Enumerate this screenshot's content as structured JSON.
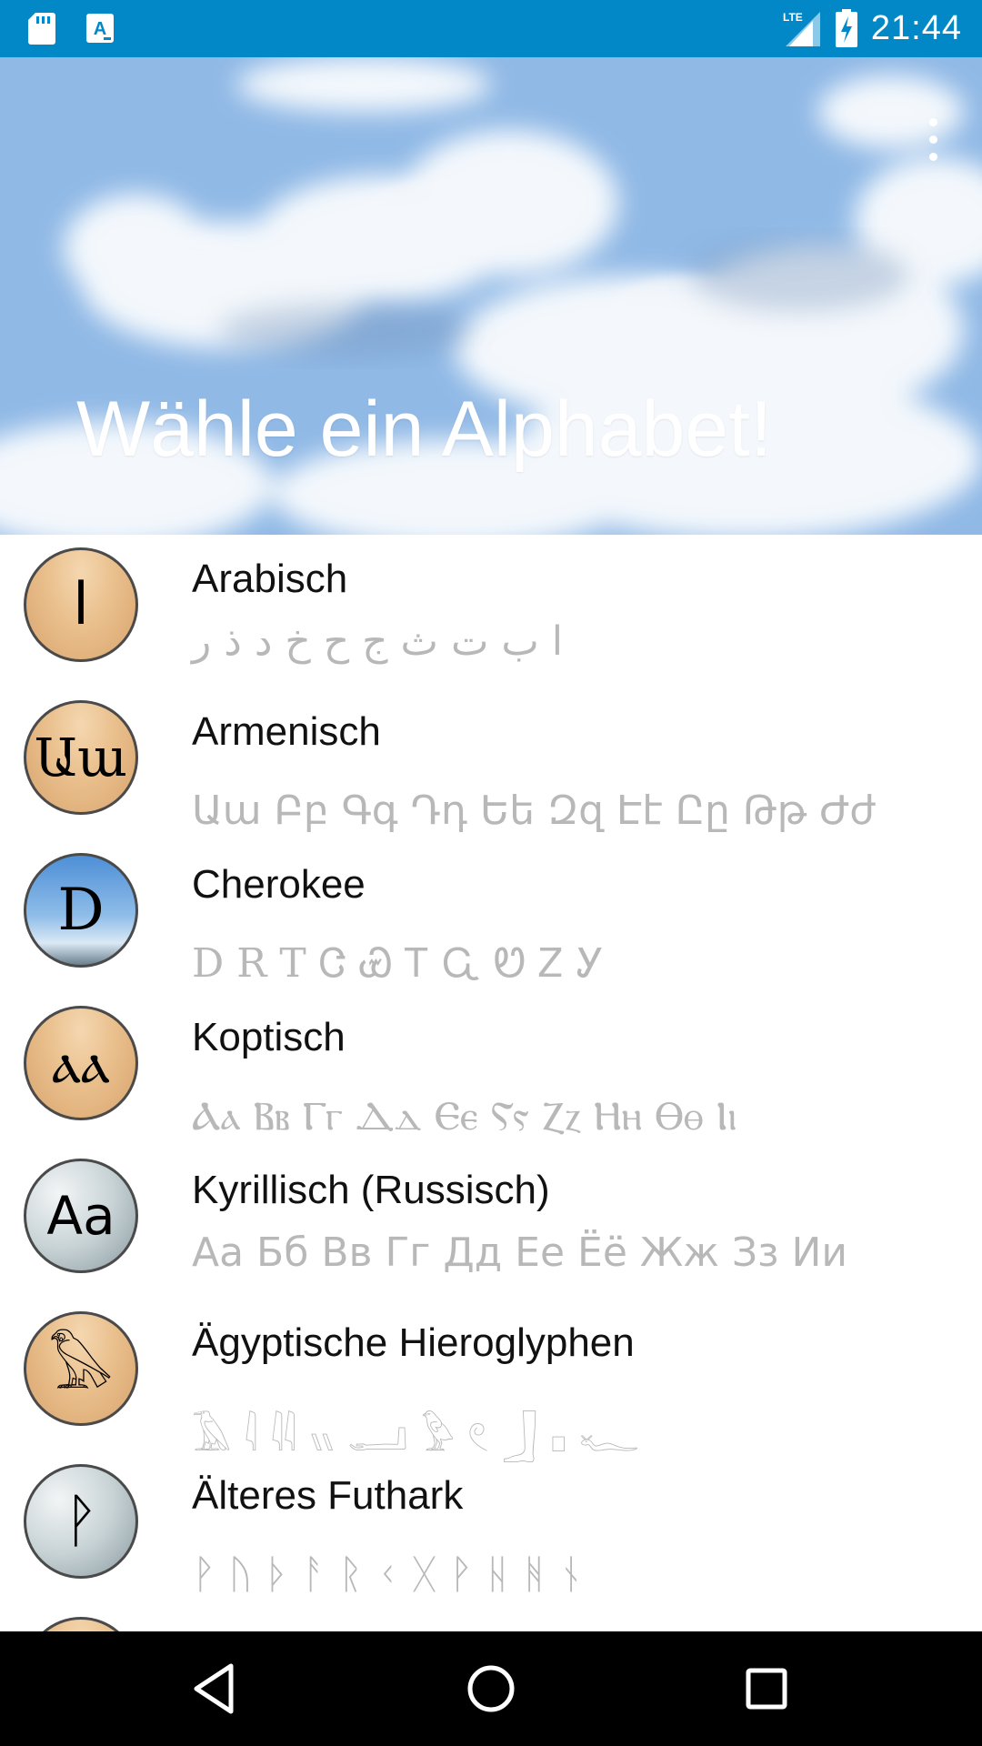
{
  "status_bar": {
    "time": "21:44",
    "network": "LTE",
    "icons": [
      "sd-card-icon",
      "app-notification-icon",
      "lte-signal-icon",
      "battery-charging-icon"
    ]
  },
  "header": {
    "title": "Wähle ein Alphabet!",
    "menu_icon": "overflow-menu-icon"
  },
  "alphabets": [
    {
      "name": "Arabisch",
      "avatar": "ا",
      "preview": "ا ب ت ث ج ح خ د ذ ر"
    },
    {
      "name": "Armenisch",
      "avatar": "Աա",
      "preview": "Աա Բբ Գգ Դդ Եե Զզ Էէ Ըը Թթ Ժժ"
    },
    {
      "name": "Cherokee",
      "avatar": "D",
      "preview": "D R T Ꮳ Ꮿ Ꭲ Ꮹ Ꮼ Ꮓ Ꭹ"
    },
    {
      "name": "Koptisch",
      "avatar": "ⲁⲁ",
      "preview": "Ⲁⲁ Ⲃⲃ Ⲅⲅ Ⲇⲇ Ⲉⲉ Ⲋⲋ Ⲍⲍ Ⲏⲏ Ⲑⲑ Ⲓⲓ"
    },
    {
      "name": "Kyrillisch (Russisch)",
      "avatar": "Aa",
      "preview": "Аа Бб Вв Гг Дд Ее Ёё Жж Зз Ии"
    },
    {
      "name": "Ägyptische Hieroglyphen",
      "avatar": "𓅃",
      "preview": "𓄿 𓇋 𓇌 𓏭 𓂝 𓅱 𓏲 𓃀 𓊪 𓆑"
    },
    {
      "name": "Älteres Futhark",
      "avatar": "ᚹ",
      "preview": "ᚹ ᚢ ᚦ ᚨ ᚱ ᚲ ᚷ ᚹ ᚺ ᚻ ᚾ"
    }
  ],
  "nav_bar": {
    "icons": [
      "back-icon",
      "home-icon",
      "recents-icon"
    ]
  }
}
